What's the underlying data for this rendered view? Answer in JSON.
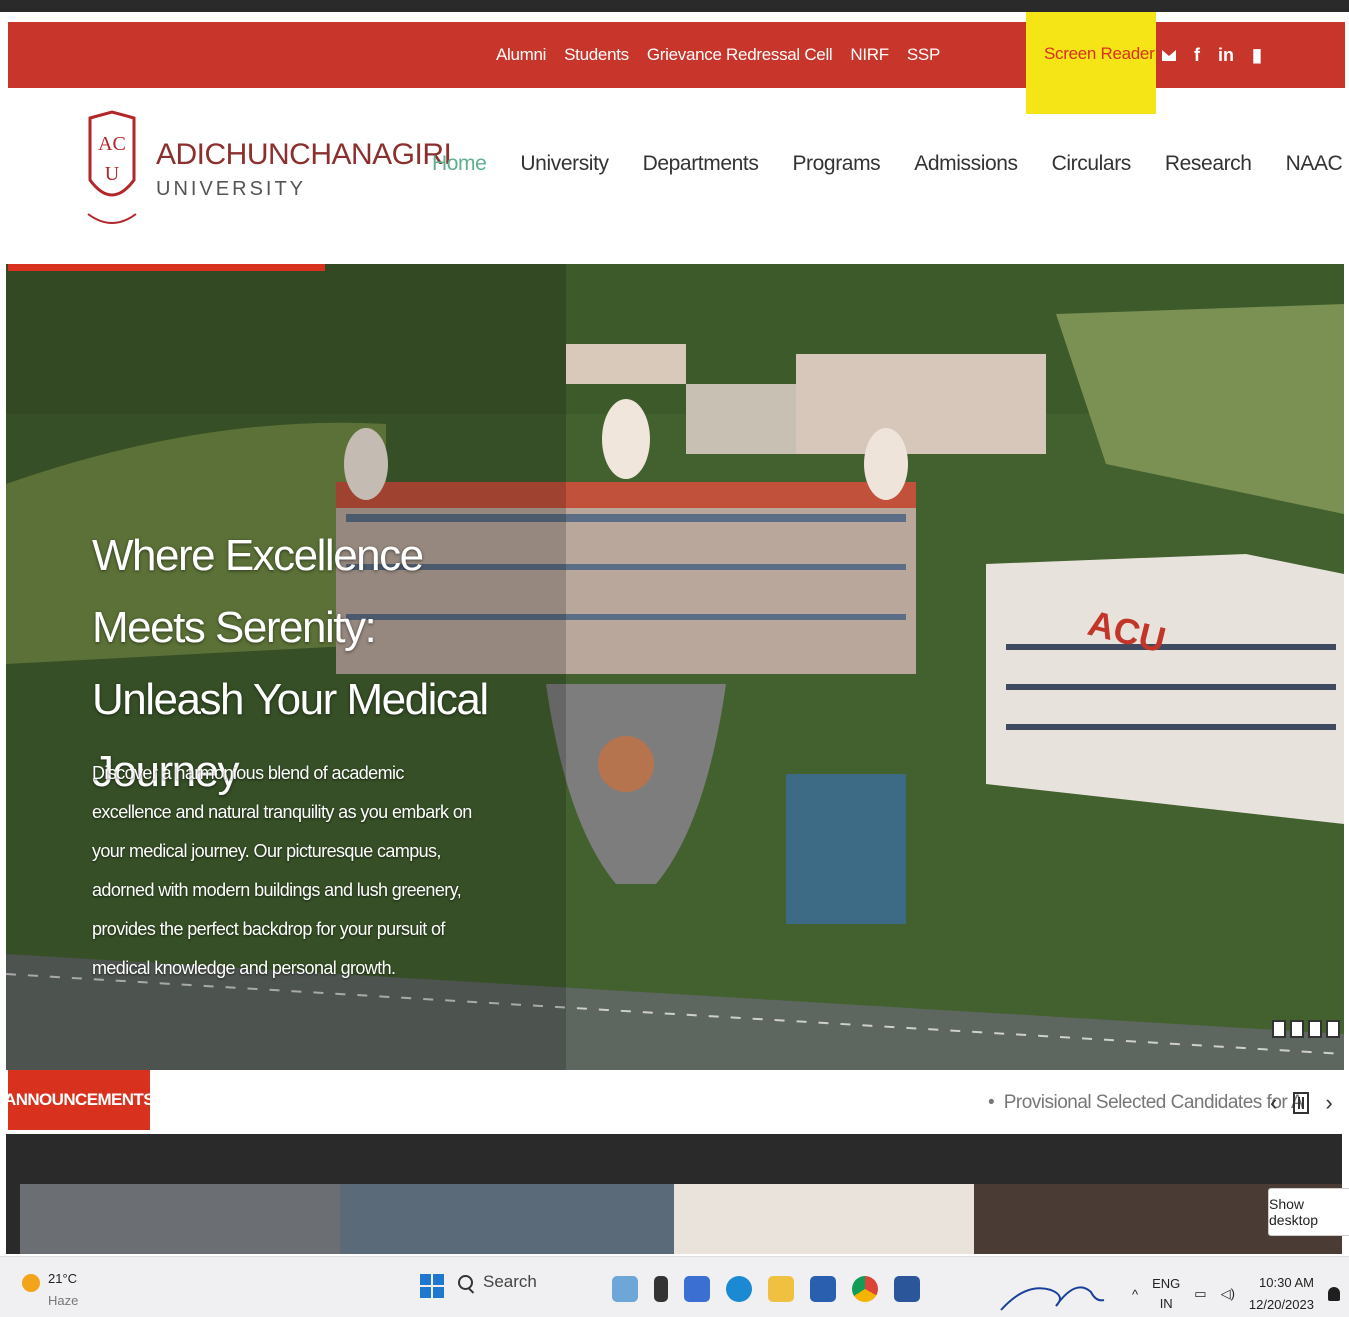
{
  "topbar": {
    "links": [
      "Alumni",
      "Students",
      "Grievance Redressal Cell",
      "NIRF",
      "SSP"
    ],
    "screen_reader": "Screen Reader",
    "social_icons": [
      "mail-icon",
      "facebook-icon",
      "linkedin-icon",
      "youtube-icon"
    ],
    "accent_color": "#c8352a",
    "highlight_color": "#f5e416"
  },
  "brand": {
    "name": "ADICHUNCHANAGIRI",
    "sub": "UNIVERSITY",
    "logo_letters": "ACU"
  },
  "nav": {
    "items": [
      "Home",
      "University",
      "Departments",
      "Programs",
      "Admissions",
      "Circulars",
      "Research",
      "NAAC"
    ],
    "active": "Home"
  },
  "hero": {
    "title": "Where Excellence Meets Serenity: Unleash Your Medical Journey",
    "description": "Discover a harmonious blend of academic excellence and natural tranquility as you embark on your medical journey. Our picturesque campus, adorned with modern buildings and lush greenery, provides the perfect backdrop for your pursuit of medical knowledge and personal growth.",
    "building_sign": "ACU"
  },
  "announcements": {
    "label": "ANNOUNCEMENTS",
    "item": "Provisional Selected Candidates for A"
  },
  "overlay": {
    "show_desktop": "Show desktop"
  },
  "taskbar": {
    "temp": "21°C",
    "weather": "Haze",
    "search_placeholder": "Search",
    "lang_top": "ENG",
    "lang_bottom": "IN",
    "time": "10:30 AM",
    "date": "12/20/2023"
  }
}
